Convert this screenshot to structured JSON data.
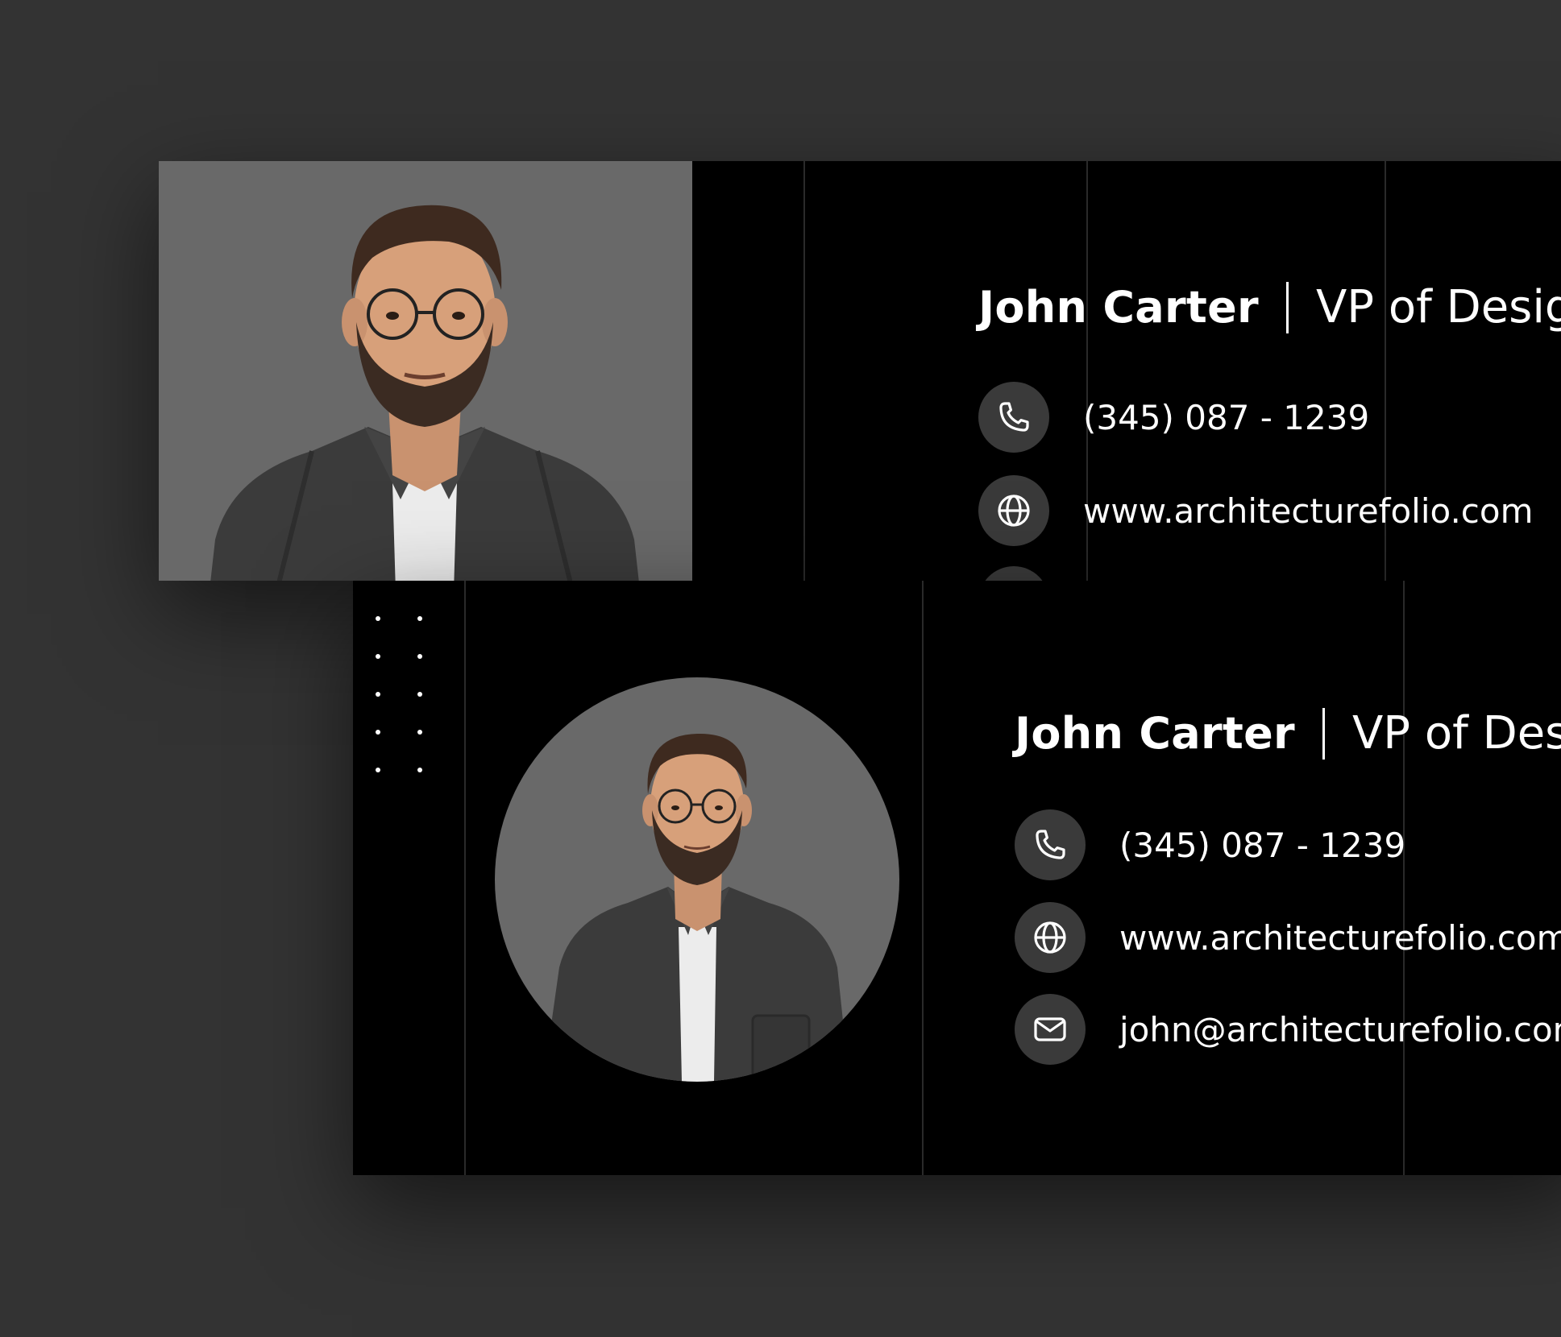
{
  "colors": {
    "background": "#333333",
    "card": "#000000",
    "photo_bg": "#696969",
    "icon_bg": "#3a3a3a",
    "text": "#ffffff"
  },
  "back_card": {
    "name": "John Carter",
    "title": "VP of Design",
    "phone": "(345) 087 - 1239",
    "website": "www.architecturefolio.com",
    "icons": [
      "phone-icon",
      "globe-icon"
    ]
  },
  "front_card": {
    "name": "John Carter",
    "title": "VP of Design",
    "phone": "(345) 087 - 1239",
    "website": "www.architecturefolio.com",
    "email": "john@architecturefolio.com",
    "icons": [
      "phone-icon",
      "globe-icon",
      "mail-icon"
    ]
  }
}
